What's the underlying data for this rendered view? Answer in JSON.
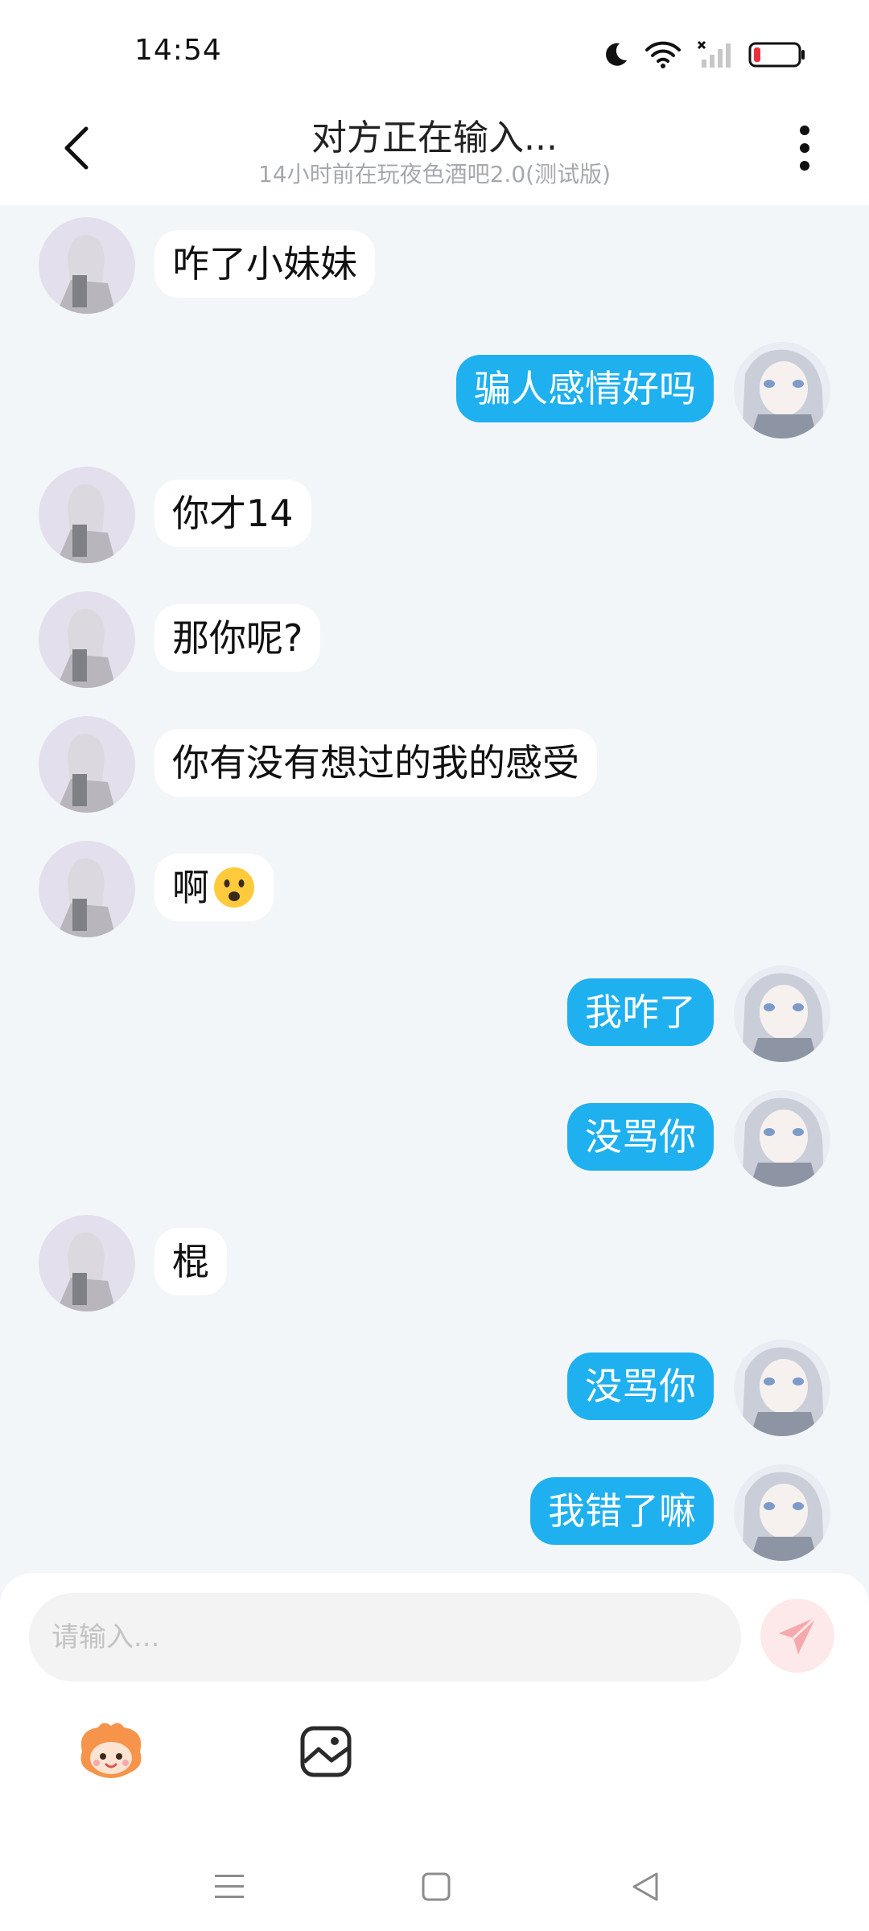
{
  "status_bar": {
    "time": "14:54",
    "icons": [
      "moon-icon",
      "wifi-icon",
      "signal-icon",
      "battery-low-icon"
    ],
    "battery_color": "#e8313f"
  },
  "header": {
    "title": "对方正在输入...",
    "subtitle": "14小时前在玩夜色酒吧2.0(测试版)",
    "back_icon": "chevron-left-icon",
    "more_icon": "more-vertical-icon"
  },
  "colors": {
    "background": "#f3f6f9",
    "outgoing_bubble": "#1fb0ef",
    "incoming_bubble": "#ffffff",
    "send_button": "#f7a8ad"
  },
  "messages": [
    {
      "side": "in",
      "text": "咋了小妹妹"
    },
    {
      "side": "out",
      "text": "骗人感情好吗"
    },
    {
      "side": "in",
      "text": "你才14"
    },
    {
      "side": "in",
      "text": "那你呢?"
    },
    {
      "side": "in",
      "text": "你有没有想过的我的感受"
    },
    {
      "side": "in",
      "text": "啊",
      "emoji": "frowning-face-emoji"
    },
    {
      "side": "out",
      "text": "我咋了"
    },
    {
      "side": "out",
      "text": "没骂你"
    },
    {
      "side": "in",
      "text": "棍"
    },
    {
      "side": "out",
      "text": "没骂你"
    },
    {
      "side": "out",
      "text": "我错了嘛"
    }
  ],
  "composer": {
    "placeholder": "请输入...",
    "send_icon": "paper-plane-icon",
    "tools": [
      "sticker-mascot-icon",
      "image-icon"
    ]
  },
  "nav_bar": {
    "icons": [
      "menu-icon",
      "home-square-icon",
      "back-triangle-icon"
    ]
  }
}
